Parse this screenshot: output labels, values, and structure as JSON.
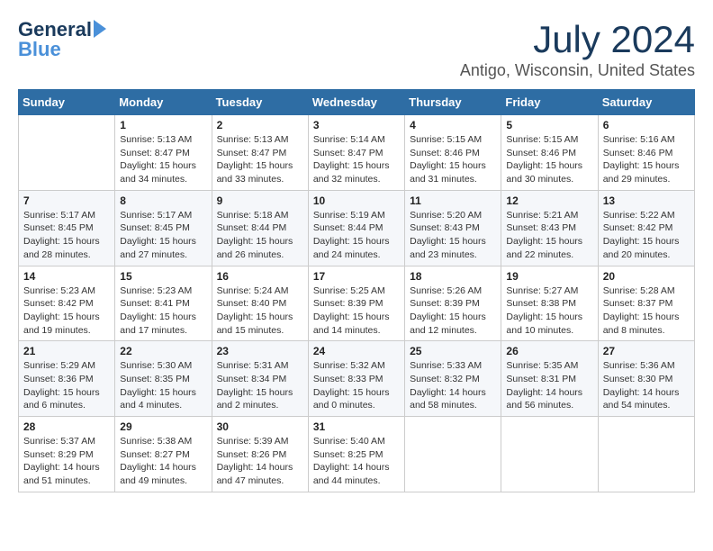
{
  "logo": {
    "general": "General",
    "blue": "Blue",
    "arrow": "▶"
  },
  "title": {
    "month_year": "July 2024",
    "location": "Antigo, Wisconsin, United States"
  },
  "days_of_week": [
    "Sunday",
    "Monday",
    "Tuesday",
    "Wednesday",
    "Thursday",
    "Friday",
    "Saturday"
  ],
  "weeks": [
    [
      {
        "day": "",
        "info": ""
      },
      {
        "day": "1",
        "info": "Sunrise: 5:13 AM\nSunset: 8:47 PM\nDaylight: 15 hours\nand 34 minutes."
      },
      {
        "day": "2",
        "info": "Sunrise: 5:13 AM\nSunset: 8:47 PM\nDaylight: 15 hours\nand 33 minutes."
      },
      {
        "day": "3",
        "info": "Sunrise: 5:14 AM\nSunset: 8:47 PM\nDaylight: 15 hours\nand 32 minutes."
      },
      {
        "day": "4",
        "info": "Sunrise: 5:15 AM\nSunset: 8:46 PM\nDaylight: 15 hours\nand 31 minutes."
      },
      {
        "day": "5",
        "info": "Sunrise: 5:15 AM\nSunset: 8:46 PM\nDaylight: 15 hours\nand 30 minutes."
      },
      {
        "day": "6",
        "info": "Sunrise: 5:16 AM\nSunset: 8:46 PM\nDaylight: 15 hours\nand 29 minutes."
      }
    ],
    [
      {
        "day": "7",
        "info": "Sunrise: 5:17 AM\nSunset: 8:45 PM\nDaylight: 15 hours\nand 28 minutes."
      },
      {
        "day": "8",
        "info": "Sunrise: 5:17 AM\nSunset: 8:45 PM\nDaylight: 15 hours\nand 27 minutes."
      },
      {
        "day": "9",
        "info": "Sunrise: 5:18 AM\nSunset: 8:44 PM\nDaylight: 15 hours\nand 26 minutes."
      },
      {
        "day": "10",
        "info": "Sunrise: 5:19 AM\nSunset: 8:44 PM\nDaylight: 15 hours\nand 24 minutes."
      },
      {
        "day": "11",
        "info": "Sunrise: 5:20 AM\nSunset: 8:43 PM\nDaylight: 15 hours\nand 23 minutes."
      },
      {
        "day": "12",
        "info": "Sunrise: 5:21 AM\nSunset: 8:43 PM\nDaylight: 15 hours\nand 22 minutes."
      },
      {
        "day": "13",
        "info": "Sunrise: 5:22 AM\nSunset: 8:42 PM\nDaylight: 15 hours\nand 20 minutes."
      }
    ],
    [
      {
        "day": "14",
        "info": "Sunrise: 5:23 AM\nSunset: 8:42 PM\nDaylight: 15 hours\nand 19 minutes."
      },
      {
        "day": "15",
        "info": "Sunrise: 5:23 AM\nSunset: 8:41 PM\nDaylight: 15 hours\nand 17 minutes."
      },
      {
        "day": "16",
        "info": "Sunrise: 5:24 AM\nSunset: 8:40 PM\nDaylight: 15 hours\nand 15 minutes."
      },
      {
        "day": "17",
        "info": "Sunrise: 5:25 AM\nSunset: 8:39 PM\nDaylight: 15 hours\nand 14 minutes."
      },
      {
        "day": "18",
        "info": "Sunrise: 5:26 AM\nSunset: 8:39 PM\nDaylight: 15 hours\nand 12 minutes."
      },
      {
        "day": "19",
        "info": "Sunrise: 5:27 AM\nSunset: 8:38 PM\nDaylight: 15 hours\nand 10 minutes."
      },
      {
        "day": "20",
        "info": "Sunrise: 5:28 AM\nSunset: 8:37 PM\nDaylight: 15 hours\nand 8 minutes."
      }
    ],
    [
      {
        "day": "21",
        "info": "Sunrise: 5:29 AM\nSunset: 8:36 PM\nDaylight: 15 hours\nand 6 minutes."
      },
      {
        "day": "22",
        "info": "Sunrise: 5:30 AM\nSunset: 8:35 PM\nDaylight: 15 hours\nand 4 minutes."
      },
      {
        "day": "23",
        "info": "Sunrise: 5:31 AM\nSunset: 8:34 PM\nDaylight: 15 hours\nand 2 minutes."
      },
      {
        "day": "24",
        "info": "Sunrise: 5:32 AM\nSunset: 8:33 PM\nDaylight: 15 hours\nand 0 minutes."
      },
      {
        "day": "25",
        "info": "Sunrise: 5:33 AM\nSunset: 8:32 PM\nDaylight: 14 hours\nand 58 minutes."
      },
      {
        "day": "26",
        "info": "Sunrise: 5:35 AM\nSunset: 8:31 PM\nDaylight: 14 hours\nand 56 minutes."
      },
      {
        "day": "27",
        "info": "Sunrise: 5:36 AM\nSunset: 8:30 PM\nDaylight: 14 hours\nand 54 minutes."
      }
    ],
    [
      {
        "day": "28",
        "info": "Sunrise: 5:37 AM\nSunset: 8:29 PM\nDaylight: 14 hours\nand 51 minutes."
      },
      {
        "day": "29",
        "info": "Sunrise: 5:38 AM\nSunset: 8:27 PM\nDaylight: 14 hours\nand 49 minutes."
      },
      {
        "day": "30",
        "info": "Sunrise: 5:39 AM\nSunset: 8:26 PM\nDaylight: 14 hours\nand 47 minutes."
      },
      {
        "day": "31",
        "info": "Sunrise: 5:40 AM\nSunset: 8:25 PM\nDaylight: 14 hours\nand 44 minutes."
      },
      {
        "day": "",
        "info": ""
      },
      {
        "day": "",
        "info": ""
      },
      {
        "day": "",
        "info": ""
      }
    ]
  ]
}
